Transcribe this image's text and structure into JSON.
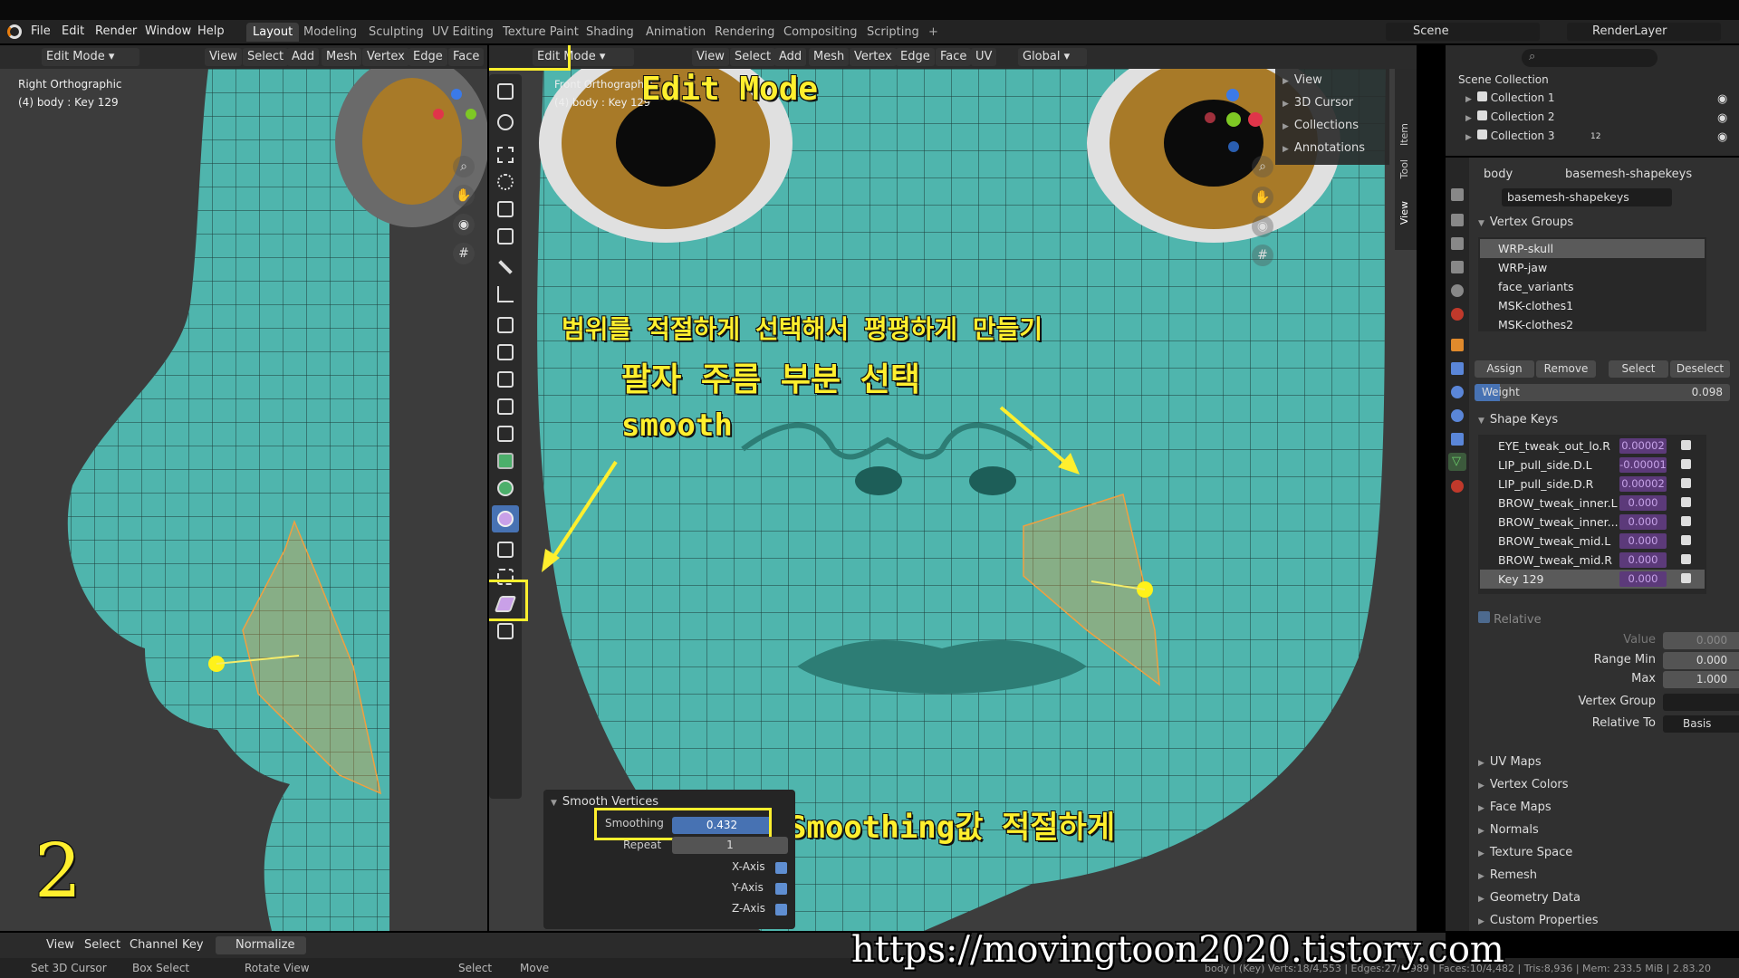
{
  "menu": {
    "file": "File",
    "edit": "Edit",
    "render": "Render",
    "window": "Window",
    "help": "Help"
  },
  "workspaces": [
    "Layout",
    "Modeling",
    "Sculpting",
    "UV Editing",
    "Texture Paint",
    "Shading",
    "Animation",
    "Rendering",
    "Compositing",
    "Scripting"
  ],
  "scene": "Scene",
  "render_layer": "RenderLayer",
  "left_header": {
    "mode": "Edit Mode",
    "items": [
      "View",
      "Select",
      "Add",
      "Mesh",
      "Vertex",
      "Edge",
      "Face"
    ]
  },
  "left_view": {
    "title": "Right Orthographic",
    "sub": "(4) body : Key 129"
  },
  "main_header": {
    "mode": "Edit Mode",
    "items": [
      "View",
      "Select",
      "Add",
      "Mesh",
      "Vertex",
      "Edge",
      "Face",
      "UV"
    ],
    "orientation": "Global"
  },
  "main_view": {
    "title": "Front Orthographic",
    "sub": "(4) body : Key 129"
  },
  "npanel": {
    "items": [
      "View",
      "3D Cursor",
      "Collections",
      "Annotations"
    ],
    "tabs": [
      "Item",
      "Tool",
      "View"
    ]
  },
  "annotations": {
    "edit_mode": "Edit Mode",
    "line1": "범위를 적절하게 선택해서 평평하게 만들기",
    "line2": "팔자 주름 부분 선택",
    "line3": "smooth",
    "smoothing": "Smoothing값 적절하게",
    "step": "2"
  },
  "operator": {
    "title": "Smooth Vertices",
    "smoothing_label": "Smoothing",
    "smoothing_value": "0.432",
    "repeat_label": "Repeat",
    "repeat_value": "1",
    "x": "X-Axis",
    "y": "Y-Axis",
    "z": "Z-Axis"
  },
  "outliner": {
    "root": "Scene Collection",
    "items": [
      "Collection 1",
      "Collection 2",
      "Collection 3"
    ],
    "c3count": "12"
  },
  "props": {
    "object": "body",
    "mesh": "basemesh-shapekeys",
    "data_name": "basemesh-shapekeys",
    "vertex_groups_title": "Vertex Groups",
    "vertex_groups": [
      "WRP-skull",
      "WRP-jaw",
      "face_variants",
      "MSK-clothes1",
      "MSK-clothes2"
    ],
    "vg_buttons": [
      "Assign",
      "Remove",
      "Select",
      "Deselect"
    ],
    "weight_label": "Weight",
    "weight_value": "0.098",
    "shape_keys_title": "Shape Keys",
    "shape_keys": [
      {
        "name": "EYE_tweak_out_lo.R",
        "value": "0.00002"
      },
      {
        "name": "LIP_pull_side.D.L",
        "value": "-0.00001"
      },
      {
        "name": "LIP_pull_side.D.R",
        "value": "0.00002"
      },
      {
        "name": "BROW_tweak_inner.L",
        "value": "0.000"
      },
      {
        "name": "BROW_tweak_inner...",
        "value": "0.000"
      },
      {
        "name": "BROW_tweak_mid.L",
        "value": "0.000"
      },
      {
        "name": "BROW_tweak_mid.R",
        "value": "0.000"
      },
      {
        "name": "Key 129",
        "value": "0.000"
      }
    ],
    "relative": "Relative",
    "value_label": "Value",
    "value": "0.000",
    "range_min_label": "Range Min",
    "range_min": "0.000",
    "max_label": "Max",
    "max": "1.000",
    "vgroup_label": "Vertex Group",
    "relative_to_label": "Relative To",
    "relative_to": "Basis",
    "sections": [
      "UV Maps",
      "Vertex Colors",
      "Face Maps",
      "Normals",
      "Texture Space",
      "Remesh",
      "Geometry Data",
      "Custom Properties"
    ]
  },
  "timeline": {
    "items": [
      "View",
      "Select",
      "Channel",
      "Key"
    ],
    "normalize": "Normalize"
  },
  "status": {
    "left": "Set 3D Cursor",
    "box": "Box Select",
    "rotate": "Rotate View",
    "select": "Select",
    "move": "Move",
    "stats": "body | (Key) Verts:18/4,553 | Edges:27/8,989 | Faces:10/4,482 | Tris:8,936 | Mem: 233.5 MiB | 2.83.20"
  },
  "watermark": "https://movingtoon2020.tistory.com",
  "colors": {
    "skin": "#4fb5ad",
    "selection": "#f0a040",
    "annotation": "#ffef2e",
    "accent": "#5f8ed1"
  }
}
